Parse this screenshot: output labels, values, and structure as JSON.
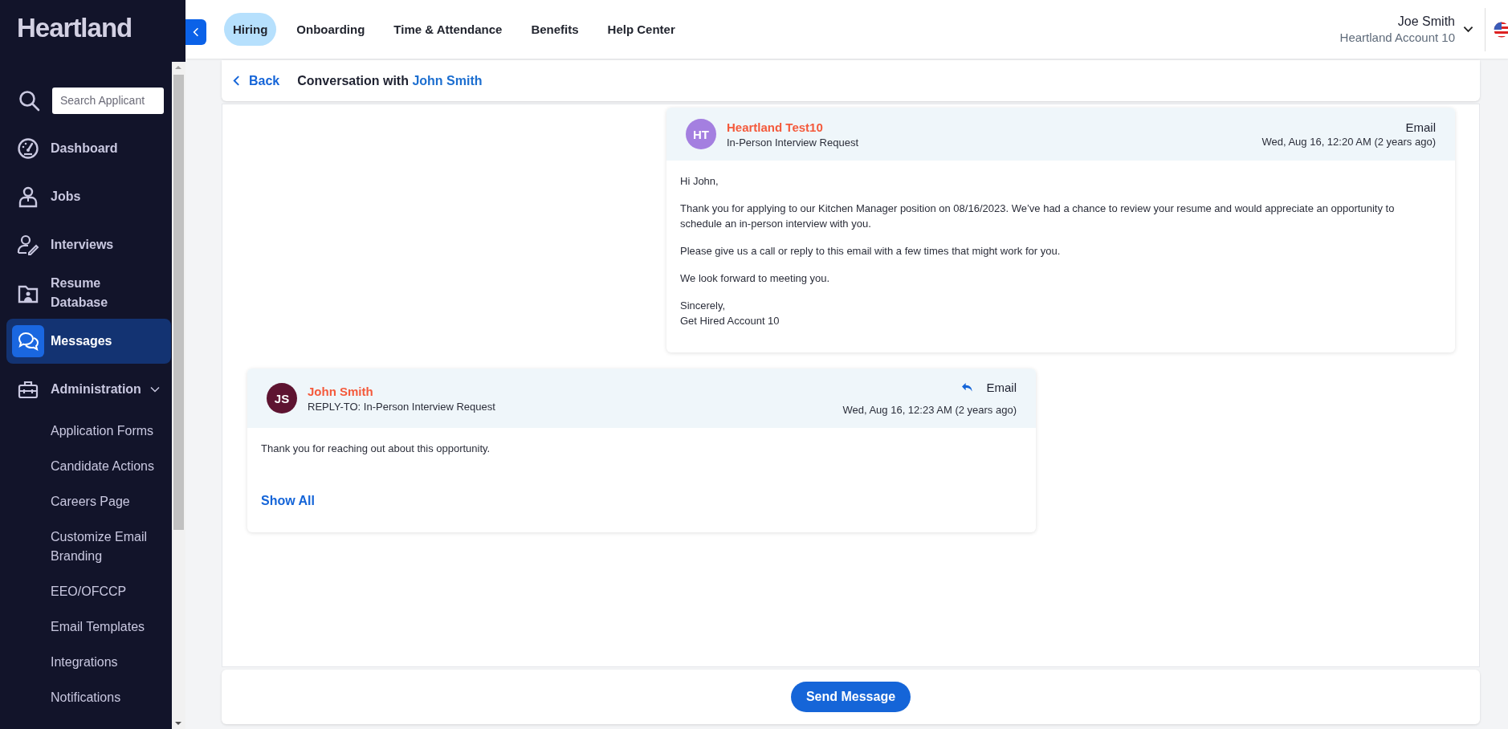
{
  "sidebar": {
    "logo": "Heartland",
    "search": {
      "placeholder": "Search Applicant"
    },
    "items": [
      {
        "label": "Dashboard",
        "selected": false
      },
      {
        "label": "Jobs",
        "selected": false
      },
      {
        "label": "Interviews",
        "selected": false
      },
      {
        "label": "Resume Database",
        "selected": false
      },
      {
        "label": "Messages",
        "selected": true
      },
      {
        "label": "Administration",
        "selected": false,
        "expanded": true,
        "children": [
          {
            "label": "Application Forms"
          },
          {
            "label": "Candidate Actions"
          },
          {
            "label": "Careers Page"
          },
          {
            "label": "Customize Email Branding"
          },
          {
            "label": "EEO/OFCCP"
          },
          {
            "label": "Email Templates"
          },
          {
            "label": "Integrations"
          },
          {
            "label": "Notifications"
          }
        ]
      }
    ]
  },
  "top_nav": {
    "tabs": [
      {
        "label": "Hiring",
        "selected": true
      },
      {
        "label": "Onboarding",
        "selected": false
      },
      {
        "label": "Time & Attendance",
        "selected": false
      },
      {
        "label": "Benefits",
        "selected": false
      },
      {
        "label": "Help Center",
        "selected": false
      }
    ],
    "user": {
      "name": "Joe Smith",
      "account": "Heartland Account 10"
    }
  },
  "conversation": {
    "back": "Back",
    "title": "Conversation with",
    "contact": "John Smith",
    "messages": [
      {
        "kind": "sent",
        "initials": "HT",
        "color": "#a47fe0",
        "sender": "Heartland Test10",
        "subject": "In-Person Interview Request",
        "channel": "Email",
        "replied": false,
        "timestamp": "Wed, Aug 16, 12:20 AM (2 years ago)",
        "paragraphs": [
          "Hi John,",
          "Thank you for applying to our Kitchen Manager position on 08/16/2023. We’ve had a chance to review your resume and would appreciate an opportunity to schedule an in-person interview with you.",
          "Please give us a call or reply to this email with a few times that might work for you.",
          "We look forward to meeting you.",
          "Sincerely,\nGet Hired Account 10"
        ]
      },
      {
        "kind": "received",
        "initials": "JS",
        "color": "#5e1431",
        "sender": "John Smith",
        "subject": "REPLY-TO: In-Person Interview Request",
        "channel": "Email",
        "replied": true,
        "timestamp": "Wed, Aug 16, 12:23 AM (2 years ago)",
        "paragraphs": [
          "Thank you for reaching out about this opportunity."
        ],
        "show_all": "Show All"
      }
    ],
    "send_button": "Send Message"
  }
}
